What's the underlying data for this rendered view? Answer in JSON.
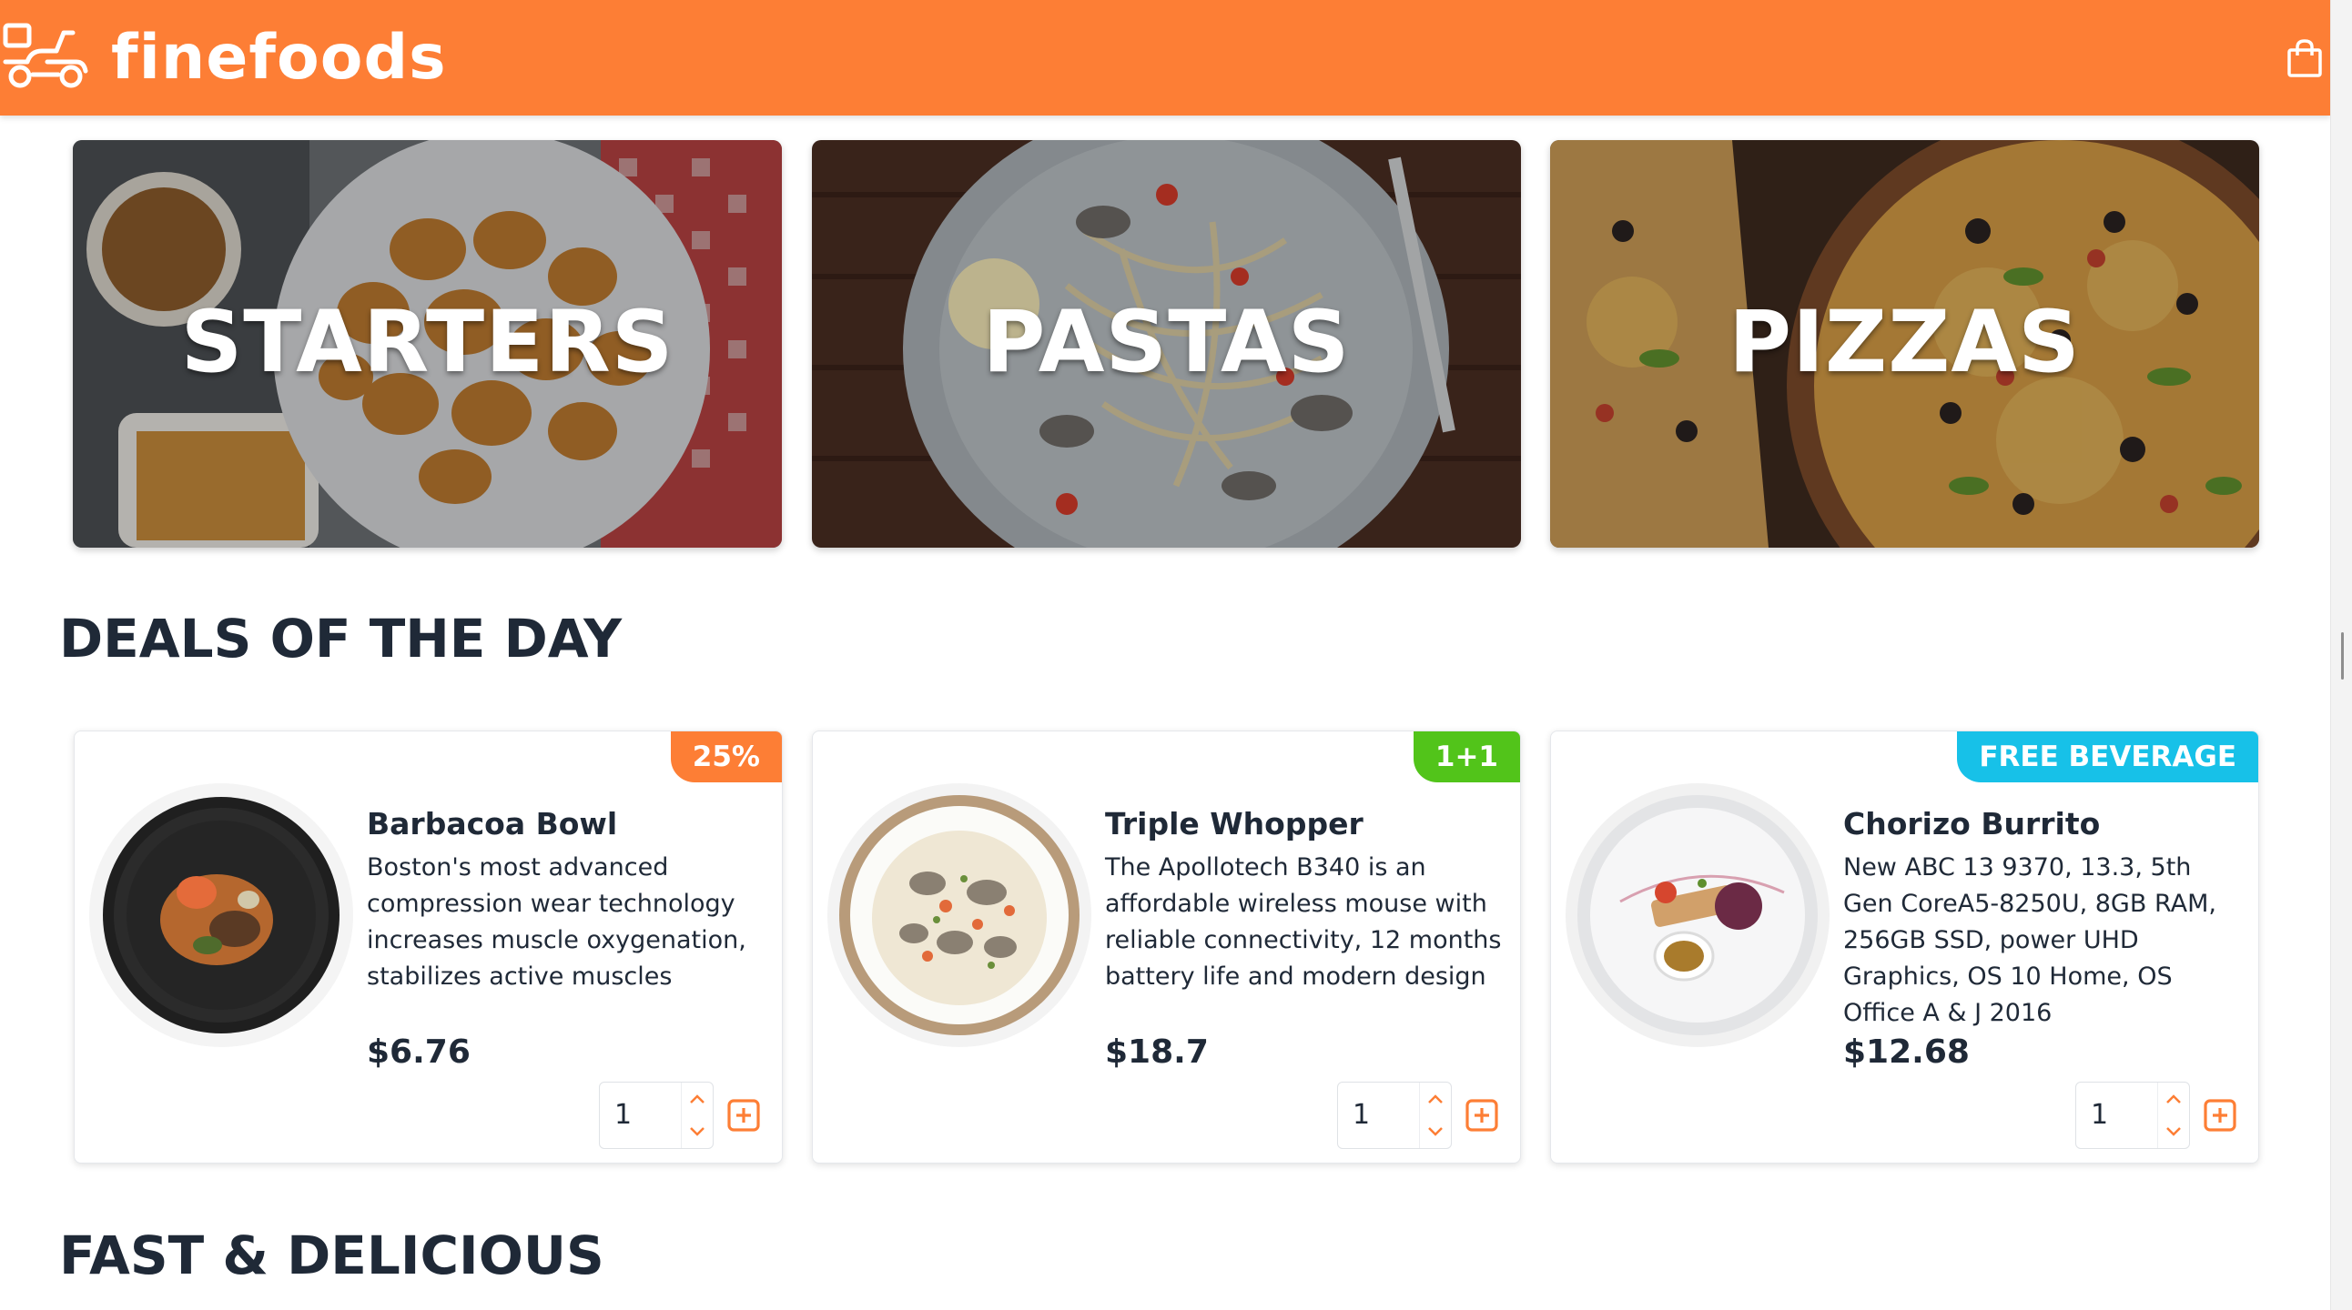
{
  "brand": {
    "name": "finefoods"
  },
  "icons": {
    "logo": "scooter-delivery-icon",
    "cart": "shopping-bag-icon",
    "add": "plus-square-icon",
    "up": "chevron-up-icon",
    "down": "chevron-down-icon"
  },
  "colors": {
    "brand": "#fd7e35",
    "text": "#1f2937",
    "badge_orange": "#fd7e35",
    "badge_green": "#52c41a",
    "badge_cyan": "#17c1e8"
  },
  "categories": [
    {
      "label": "STARTERS"
    },
    {
      "label": "PASTAS"
    },
    {
      "label": "PIZZAS"
    }
  ],
  "sections": {
    "deals_title": "DEALS OF THE DAY",
    "fast_title": "FAST & DELICIOUS"
  },
  "deals": [
    {
      "badge": "25%",
      "name": "Barbacoa Bowl",
      "description": "Boston's most advanced compression wear technology increases muscle oxygenation, stabilizes active muscles",
      "price": "$6.76",
      "quantity": "1"
    },
    {
      "badge": "1+1",
      "name": "Triple Whopper",
      "description": "The Apollotech B340 is an affordable wireless mouse with reliable connectivity, 12 months battery life and modern design",
      "price": "$18.7",
      "quantity": "1"
    },
    {
      "badge": "FREE BEVERAGE",
      "name": "Chorizo Burrito",
      "description": "New ABC 13 9370, 13.3, 5th Gen CoreA5-8250U, 8GB RAM, 256GB SSD, power UHD Graphics, OS 10 Home, OS Office A & J 2016",
      "price": "$12.68",
      "quantity": "1"
    }
  ]
}
